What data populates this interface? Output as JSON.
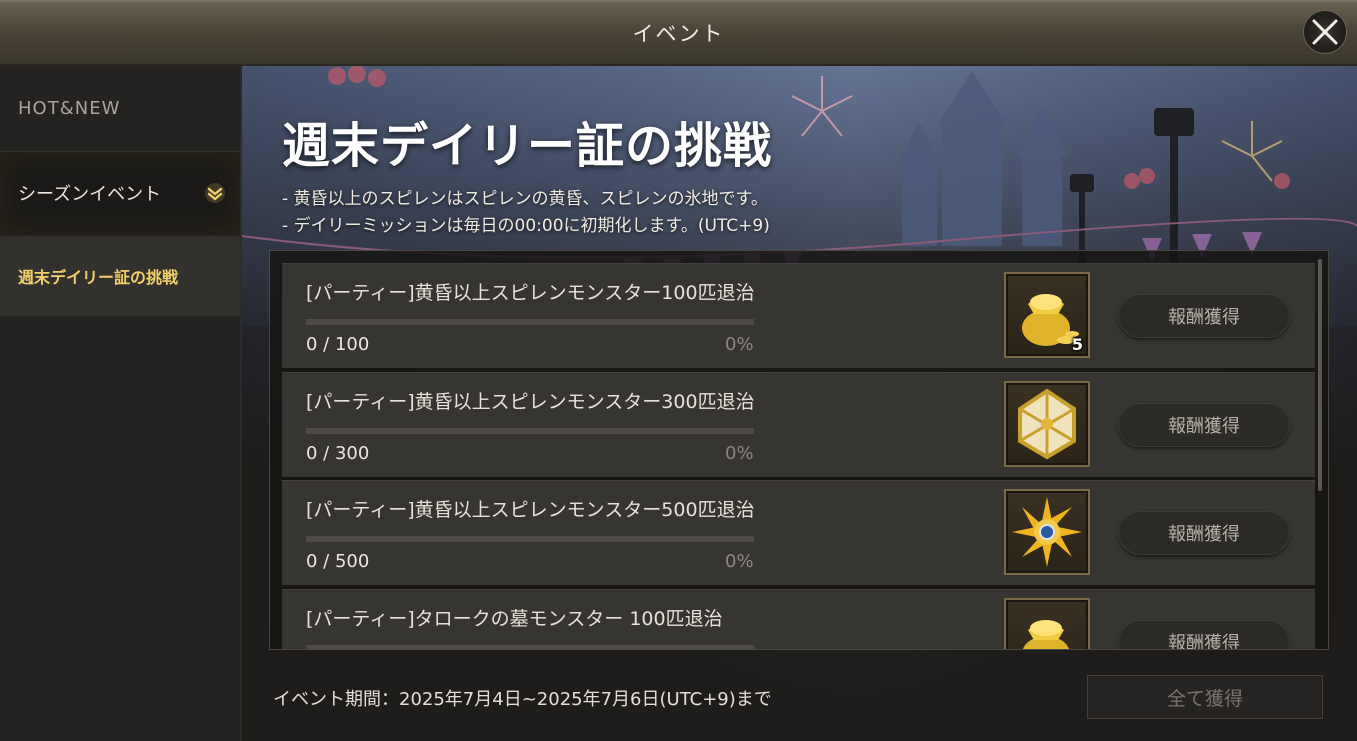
{
  "window": {
    "title": "イベント",
    "close_icon": "close-icon"
  },
  "sidebar": {
    "items": [
      {
        "label": "HOT&NEW"
      },
      {
        "label": "シーズンイベント",
        "icon": "chevron-down-icon"
      },
      {
        "label": "週末デイリー証の挑戦",
        "selected": true
      }
    ]
  },
  "main": {
    "title": "週末デイリー証の挑戦",
    "description": [
      "- 黄昏以上のスピレンはスピレンの黄昏、スピレンの氷地です。",
      "- デイリーミッションは毎日の00:00に初期化します。(UTC+9)"
    ],
    "missions": [
      {
        "title": "[パーティー]黄昏以上スピレンモンスター100匹退治",
        "progress_text": "0 / 100",
        "percent_text": "0%",
        "progress": 0,
        "reward_icon": "gold-sack-icon",
        "reward_qty": "5",
        "button": "報酬獲得"
      },
      {
        "title": "[パーティー]黄昏以上スピレンモンスター300匹退治",
        "progress_text": "0 / 300",
        "percent_text": "0%",
        "progress": 0,
        "reward_icon": "treasure-chest-icon",
        "reward_qty": "",
        "button": "報酬獲得"
      },
      {
        "title": "[パーティー]黄昏以上スピレンモンスター500匹退治",
        "progress_text": "0 / 500",
        "percent_text": "0%",
        "progress": 0,
        "reward_icon": "sun-emblem-icon",
        "reward_qty": "",
        "button": "報酬獲得"
      },
      {
        "title": "[パーティー]タロークの墓モンスター 100匹退治",
        "progress_text": "",
        "percent_text": "",
        "progress": 0,
        "reward_icon": "gold-sack-icon",
        "reward_qty": "",
        "button": "報酬獲得"
      }
    ],
    "event_period": "イベント期間：2025年7月4日~2025年7月6日(UTC+9)まで",
    "claim_all": "全て獲得"
  },
  "colors": {
    "accent_gold": "#f3cf6b",
    "title_bar": "#4d4739",
    "row_bg": "#373532"
  }
}
